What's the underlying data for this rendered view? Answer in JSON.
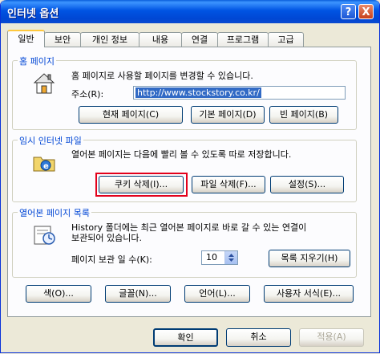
{
  "window": {
    "title": "인터넷 옵션",
    "help_label": "?",
    "close_label": "X"
  },
  "tabs": [
    {
      "label": "일반",
      "active": true
    },
    {
      "label": "보안"
    },
    {
      "label": "개인 정보"
    },
    {
      "label": "내용"
    },
    {
      "label": "연결"
    },
    {
      "label": "프로그램"
    },
    {
      "label": "고급"
    }
  ],
  "home_page": {
    "label": "홈 페이지",
    "description": "홈 페이지로 사용할 페이지를 변경할 수 있습니다.",
    "address_label": "주소(R):",
    "address_value": "http://www.stockstory.co.kr/",
    "buttons": [
      "현재 페이지(C)",
      "기본 페이지(D)",
      "빈 페이지(B)"
    ]
  },
  "temp_files": {
    "label": "임시 인터넷 파일",
    "description": "열어본 페이지는 다음에 빨리 볼 수 있도록 따로 저장합니다.",
    "buttons": [
      "쿠키 삭제(I)...",
      "파일 삭제(F)...",
      "설정(S)..."
    ]
  },
  "history": {
    "label": "열어본 페이지 목록",
    "description_line1": "History 폴더에는 최근 열어본 페이지로 바로 갈 수 있는 연결이",
    "description_line2": "보관되어 있습니다.",
    "days_label": "페이지 보관 일 수(K):",
    "days_value": "10",
    "clear_button": "목록 지우기(H)"
  },
  "bottom_buttons": [
    "색(O)...",
    "글꼴(N)...",
    "언어(L)...",
    "사용자 서식(E)..."
  ],
  "dialog_buttons": {
    "ok": "확인",
    "cancel": "취소",
    "apply": "적용(A)"
  }
}
